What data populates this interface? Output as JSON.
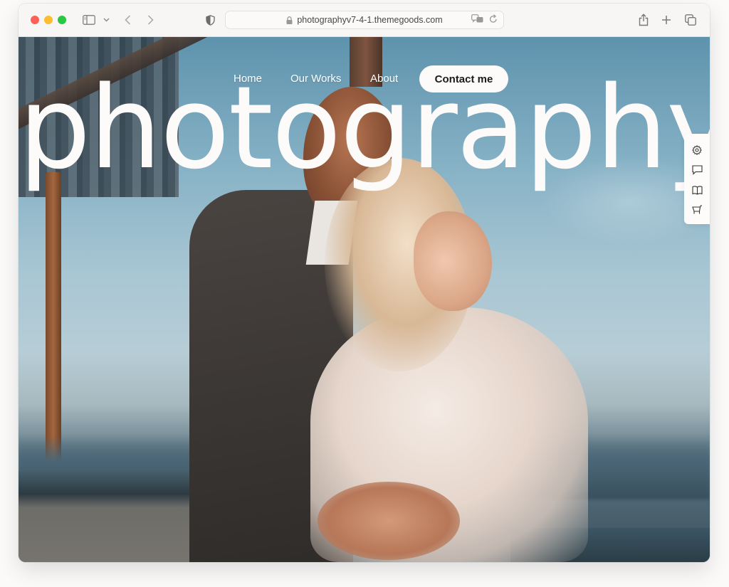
{
  "browser": {
    "url": "photographyv7-4-1.themegoods.com",
    "icons": {
      "sidebar": "sidebar-toggle-icon",
      "sidebar_menu": "chevron-down-icon",
      "back": "chevron-left-icon",
      "forward": "chevron-right-icon",
      "privacy": "shield-icon",
      "lock": "lock-icon",
      "translate": "translate-icon",
      "reload": "reload-icon",
      "share": "share-icon",
      "new_tab": "plus-icon",
      "tabs": "tab-overview-icon"
    }
  },
  "site": {
    "hero_title": "photography",
    "nav": {
      "items": [
        {
          "label": "Home"
        },
        {
          "label": "Our Works"
        },
        {
          "label": "About"
        }
      ],
      "cta_label": "Contact me"
    },
    "side_panel": {
      "items": [
        {
          "icon": "gear-icon"
        },
        {
          "icon": "chat-icon"
        },
        {
          "icon": "book-icon"
        },
        {
          "icon": "cart-icon"
        }
      ]
    },
    "hero_image": "couple-rooftop-photo"
  }
}
